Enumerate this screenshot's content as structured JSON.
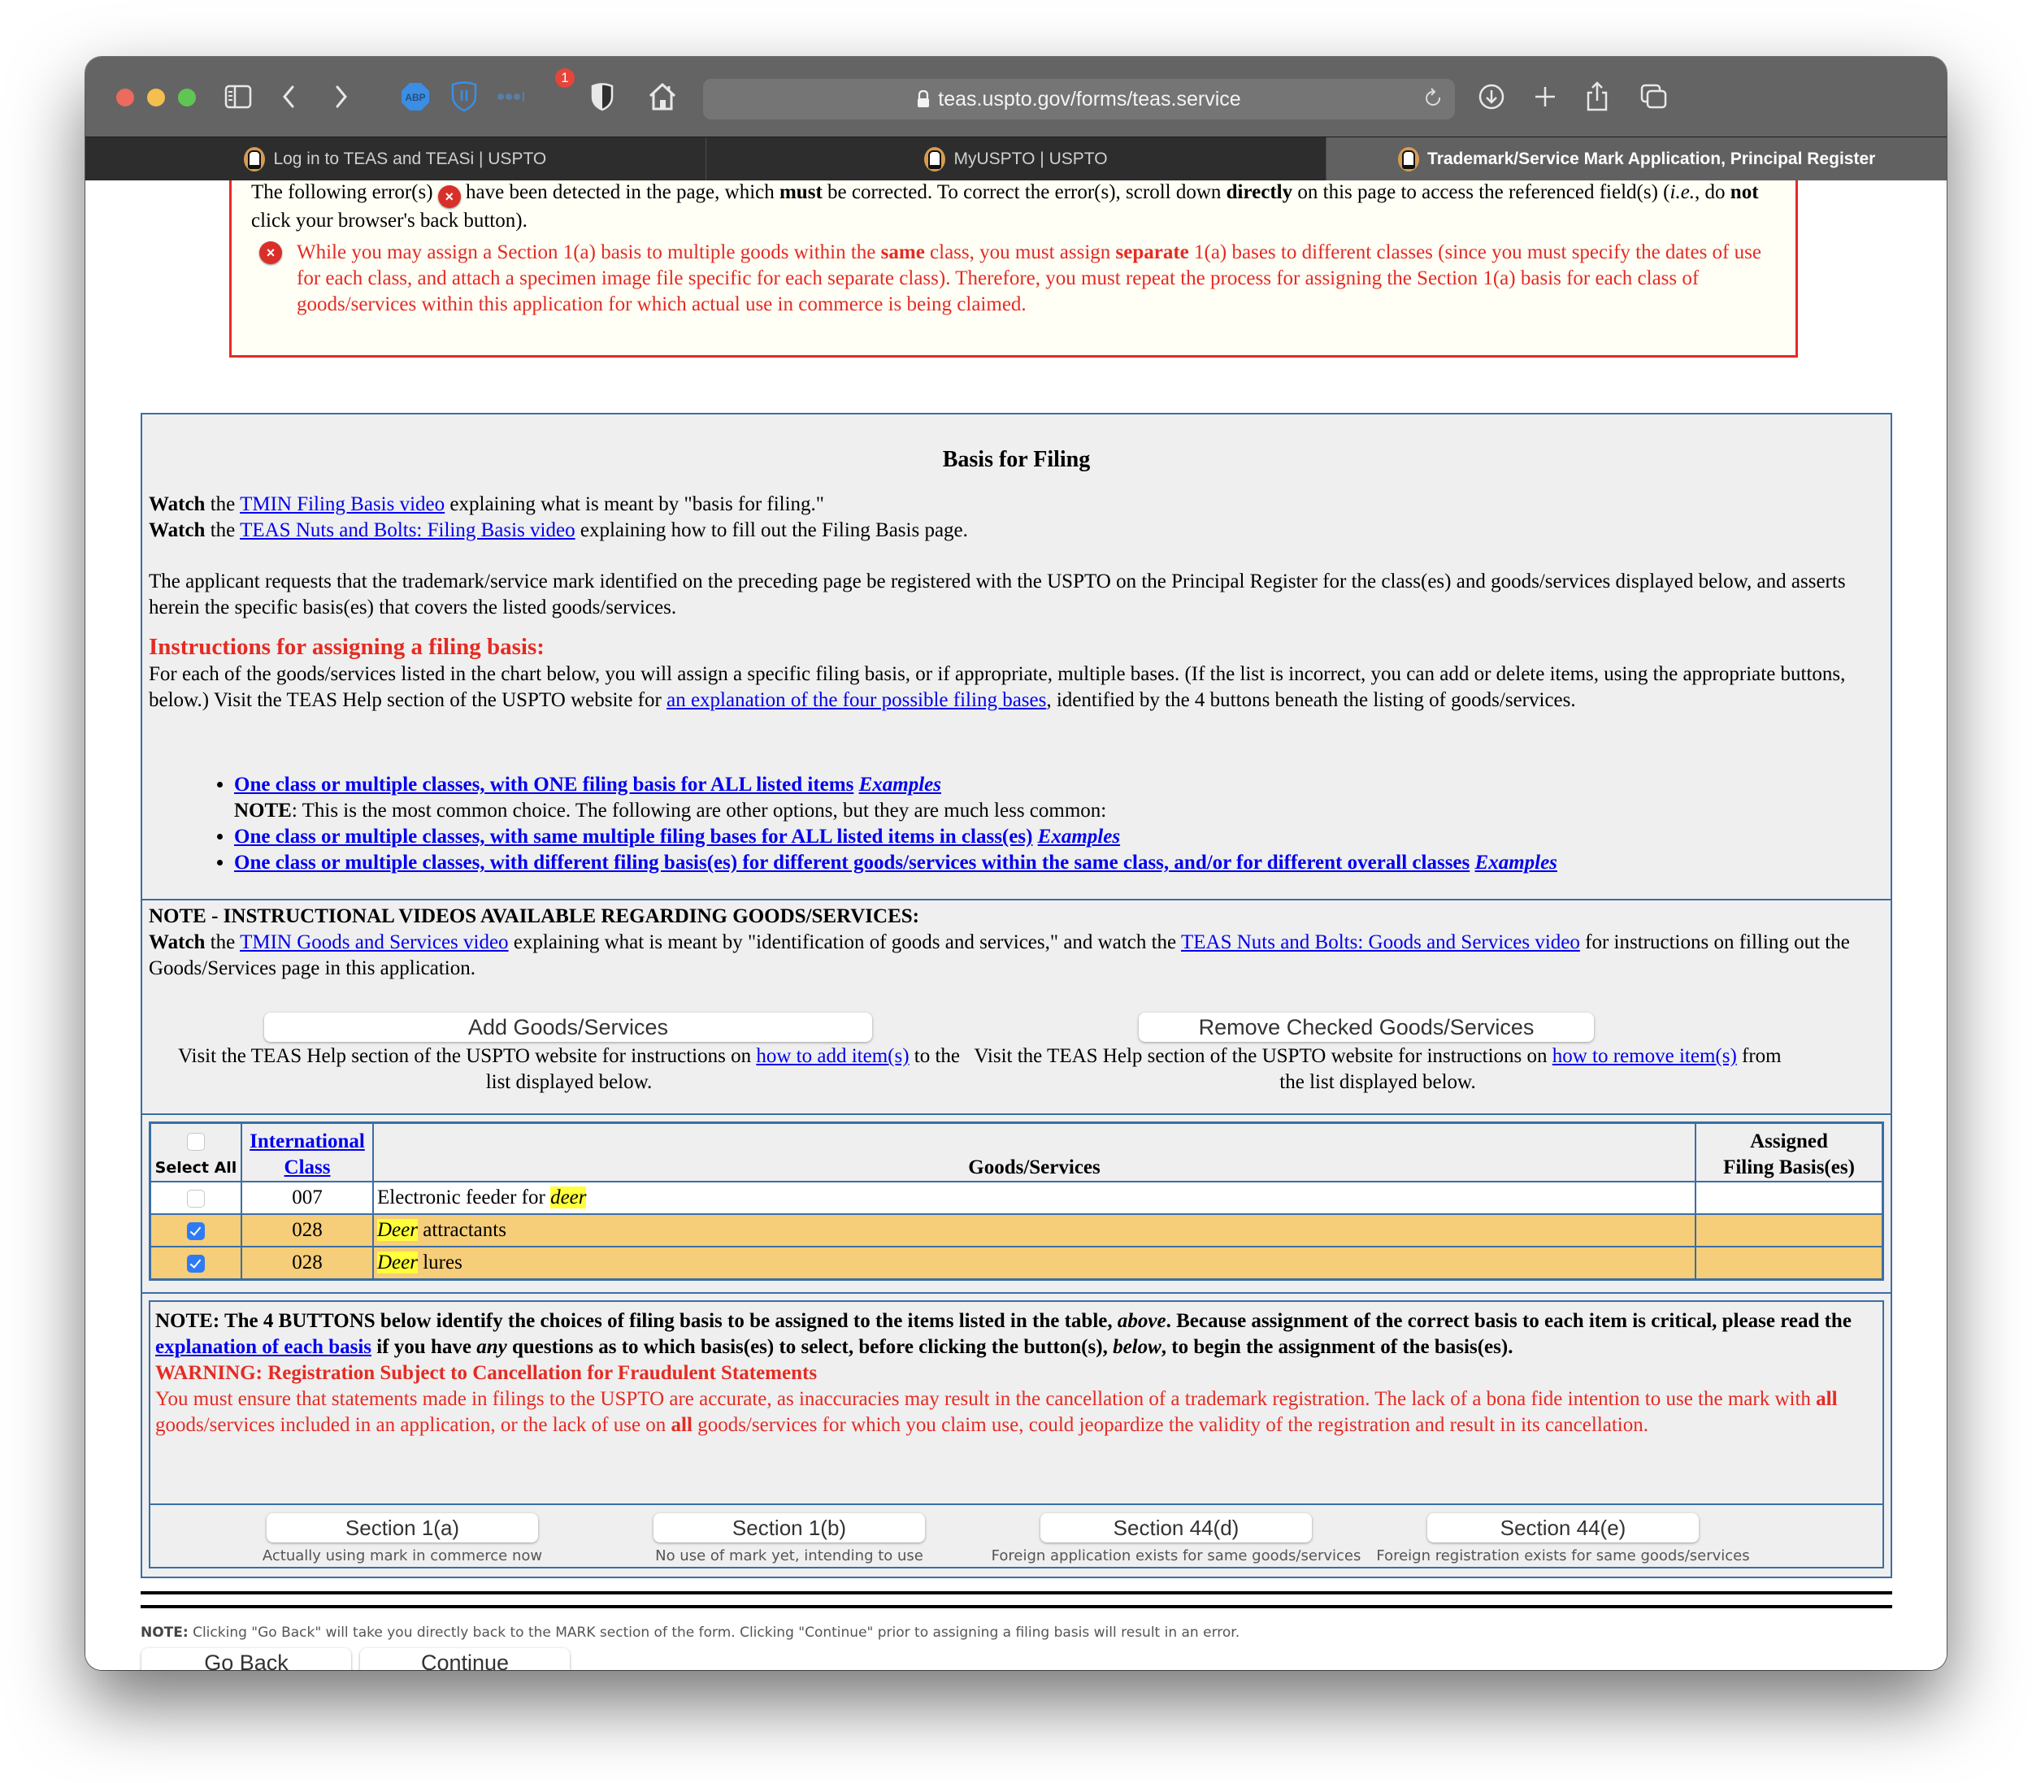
{
  "browser": {
    "url": "teas.uspto.gov/forms/teas.service",
    "notification_badge": "1",
    "toolbar_icons": [
      "sidebar-icon",
      "back-icon",
      "forward-icon",
      "adblock-plus-icon",
      "bitwarden-icon",
      "extension-dots-icon",
      "privacy-shield-icon",
      "home-icon",
      "reload-icon",
      "download-icon",
      "new-tab-icon",
      "share-icon",
      "tab-overview-icon"
    ],
    "tabs": [
      {
        "label": "Log in to TEAS and TEASi | USPTO",
        "active": false
      },
      {
        "label": "MyUSPTO | USPTO",
        "active": false
      },
      {
        "label": "Trademark/Service Mark Application, Principal Register",
        "active": true
      }
    ]
  },
  "error_box": {
    "line1_a": "The following error(s)",
    "line1_b": "have been detected in the page, which",
    "line1_must": "must",
    "line1_c": "be corrected. To correct the error(s), scroll down",
    "line1_directly": "directly",
    "line1_d": "on this page to access the referenced field(s) (",
    "line1_ie": "i.e.",
    "line1_e": ", do",
    "line1_not": "not",
    "line1_f": "click your browser's back button).",
    "error_icon": "×",
    "message_a": "While you may assign a Section 1(a) basis to multiple goods within the",
    "message_same": "same",
    "message_b": "class, you must assign",
    "message_separate": "separate",
    "message_c": "1(a) bases to different classes (since you must specify the dates of use for each class, and attach a specimen image file specific for each separate class). Therefore, you must repeat the process for assigning the Section 1(a) basis for each class of goods/services within this application for which actual use in commerce is being claimed."
  },
  "basis": {
    "title": "Basis for Filing",
    "watch_word": "Watch",
    "the_word": "the",
    "video1_link": "TMIN Filing Basis video",
    "video1_rest": "explaining what is meant by \"basis for filing.\"",
    "video2_link": "TEAS Nuts and Bolts: Filing Basis video",
    "video2_rest": "explaining how to fill out the Filing Basis page.",
    "applicant_text": "The applicant requests that the trademark/service mark identified on the preceding page be registered with the USPTO on the Principal Register for the class(es) and goods/services displayed below, and asserts herein the specific basis(es) that covers the listed goods/services.",
    "instructions_heading": "Instructions for assigning a filing basis:",
    "instructions_a": "For each of the goods/services listed in the chart below, you will assign a specific filing basis, or if appropriate, multiple bases. (If the list is incorrect, you can add or delete items, using the appropriate buttons, below.) Visit the TEAS Help section of the USPTO website for",
    "instructions_link": "an explanation of the four possible filing bases",
    "instructions_b": ", identified by the 4 buttons beneath the listing of goods/services.",
    "options": [
      {
        "label": "One class or multiple classes, with ONE filing basis for ALL listed items",
        "examples": "Examples"
      },
      {
        "label": "One class or multiple classes, with same multiple filing bases for ALL listed items in class(es)",
        "examples": "Examples"
      },
      {
        "label": "One class or multiple classes, with different filing basis(es) for different goods/services within the same class, and/or for different overall classes",
        "examples": "Examples"
      }
    ],
    "note_bold": "NOTE",
    "note_text": ": This is the most common choice. The following are other options, but they are much less common:"
  },
  "goods_videos": {
    "heading": "NOTE - INSTRUCTIONAL VIDEOS AVAILABLE REGARDING GOODS/SERVICES:",
    "watch_word": "Watch",
    "the_word": "the",
    "link1": "TMIN Goods and Services video",
    "text1": "explaining what is meant by \"identification of goods and services,\" and watch the",
    "link2": "TEAS Nuts and Bolts: Goods and Services video",
    "text2": "for instructions on filling out the Goods/Services page in this application.",
    "add_button": "Add Goods/Services",
    "remove_button": "Remove Checked Goods/Services",
    "add_help_a": "Visit the TEAS Help section of the USPTO website for instructions on",
    "add_help_link": "how to add item(s)",
    "add_help_b": "to the list displayed below.",
    "remove_help_a": "Visit the TEAS Help section of the USPTO website for instructions on",
    "remove_help_link": "how to remove item(s)",
    "remove_help_b": "from the list displayed below."
  },
  "table": {
    "headers": {
      "select_all": "Select All",
      "class_line1": "International",
      "class_line2": "Class",
      "goods": "Goods/Services",
      "basis_line1": "Assigned",
      "basis_line2": "Filing Basis(es)"
    },
    "select_all_checked": false,
    "rows": [
      {
        "checked": false,
        "class": "007",
        "pre": "Electronic feeder for ",
        "highlight": "deer",
        "post": "",
        "basis": ""
      },
      {
        "checked": true,
        "class": "028",
        "pre": "",
        "highlight": "Deer",
        "post": " attractants",
        "basis": ""
      },
      {
        "checked": true,
        "class": "028",
        "pre": "",
        "highlight": "Deer",
        "post": " lures",
        "basis": ""
      }
    ]
  },
  "buttons_note": {
    "text_a": "NOTE: The 4 BUTTONS below identify the choices of filing basis to be assigned to the items listed in the table,",
    "above": "above",
    "text_b": ". Because assignment of the correct basis to each item is critical, please read the",
    "link": "explanation of each basis",
    "text_c": "if you have",
    "any": "any",
    "text_d": "questions as to which basis(es) to select, before clicking the button(s),",
    "below": "below",
    "text_e": ", to begin the assignment of the basis(es).",
    "warning_heading": "WARNING: Registration Subject to Cancellation for Fraudulent Statements",
    "warning_a": "You must ensure that statements made in filings to the USPTO are accurate, as inaccuracies may result in the cancellation of a trademark registration. The lack of a bona fide intention to use the mark with",
    "warning_all1": "all",
    "warning_b": "goods/services included in an application, or the lack of use on",
    "warning_all2": "all",
    "warning_c": "goods/services for which you claim use, could jeopardize the validity of the registration and result in its cancellation."
  },
  "section_buttons": [
    {
      "label": "Section 1(a)",
      "caption": "Actually using mark in commerce now"
    },
    {
      "label": "Section 1(b)",
      "caption": "No use of mark yet, intending to use"
    },
    {
      "label": "Section 44(d)",
      "caption": "Foreign application exists for same goods/services"
    },
    {
      "label": "Section 44(e)",
      "caption": "Foreign registration exists for same goods/services"
    }
  ],
  "footer": {
    "note_bold": "NOTE:",
    "note_text": " Clicking \"Go Back\" will take you directly back to the MARK section of the form. Clicking \"Continue\" prior to assigning a filing basis will result in an error.",
    "go_back": "Go Back",
    "continue": "Continue"
  },
  "colors": {
    "error_red": "#e42b23",
    "border_blue": "#3a6ea5",
    "selected_row": "#f6cd78",
    "highlight": "#ffff3a",
    "link": "#0000ee"
  }
}
